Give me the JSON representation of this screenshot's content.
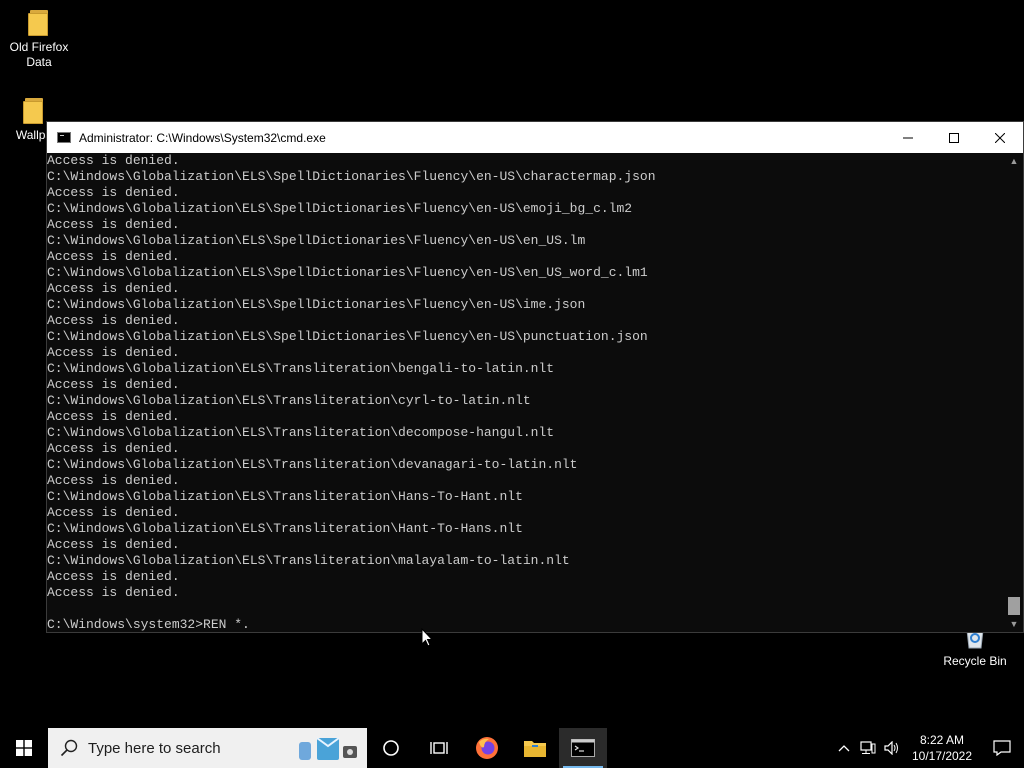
{
  "desktop": {
    "icons": [
      {
        "label": "Old Firefox\nData"
      },
      {
        "label": "Wallpa"
      },
      {
        "label": "Recycle Bin"
      }
    ]
  },
  "cmd": {
    "title": "Administrator: C:\\Windows\\System32\\cmd.exe",
    "lines": [
      "Access is denied.",
      "C:\\Windows\\Globalization\\ELS\\SpellDictionaries\\Fluency\\en-US\\charactermap.json",
      "Access is denied.",
      "C:\\Windows\\Globalization\\ELS\\SpellDictionaries\\Fluency\\en-US\\emoji_bg_c.lm2",
      "Access is denied.",
      "C:\\Windows\\Globalization\\ELS\\SpellDictionaries\\Fluency\\en-US\\en_US.lm",
      "Access is denied.",
      "C:\\Windows\\Globalization\\ELS\\SpellDictionaries\\Fluency\\en-US\\en_US_word_c.lm1",
      "Access is denied.",
      "C:\\Windows\\Globalization\\ELS\\SpellDictionaries\\Fluency\\en-US\\ime.json",
      "Access is denied.",
      "C:\\Windows\\Globalization\\ELS\\SpellDictionaries\\Fluency\\en-US\\punctuation.json",
      "Access is denied.",
      "C:\\Windows\\Globalization\\ELS\\Transliteration\\bengali-to-latin.nlt",
      "Access is denied.",
      "C:\\Windows\\Globalization\\ELS\\Transliteration\\cyrl-to-latin.nlt",
      "Access is denied.",
      "C:\\Windows\\Globalization\\ELS\\Transliteration\\decompose-hangul.nlt",
      "Access is denied.",
      "C:\\Windows\\Globalization\\ELS\\Transliteration\\devanagari-to-latin.nlt",
      "Access is denied.",
      "C:\\Windows\\Globalization\\ELS\\Transliteration\\Hans-To-Hant.nlt",
      "Access is denied.",
      "C:\\Windows\\Globalization\\ELS\\Transliteration\\Hant-To-Hans.nlt",
      "Access is denied.",
      "C:\\Windows\\Globalization\\ELS\\Transliteration\\malayalam-to-latin.nlt",
      "Access is denied.",
      "Access is denied.",
      "",
      "C:\\Windows\\system32>REN *."
    ]
  },
  "taskbar": {
    "search_placeholder": "Type here to search",
    "clock_time": "8:22 AM",
    "clock_date": "10/17/2022",
    "accent": "#76b9ed"
  }
}
